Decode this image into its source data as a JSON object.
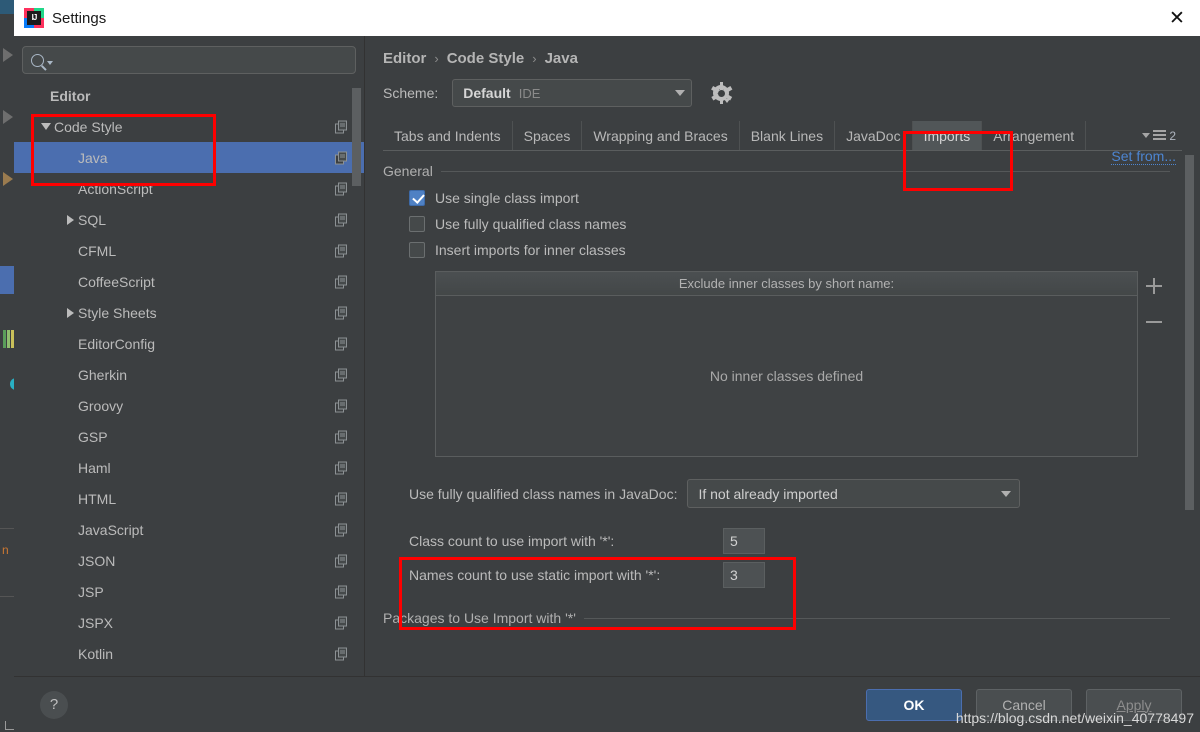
{
  "window": {
    "title": "Settings",
    "app_icon": "intellij-idea-icon",
    "close_label": "✕"
  },
  "sidebar": {
    "search": {
      "value": "",
      "placeholder": "",
      "icon": "search-icon"
    },
    "items": [
      {
        "label": "Editor",
        "type": "header",
        "indent": 0,
        "twisty": "none",
        "copy": false,
        "selected": false
      },
      {
        "label": "Code Style",
        "type": "group",
        "indent": 0,
        "twisty": "down",
        "copy": true,
        "selected": false
      },
      {
        "label": "Java",
        "type": "leaf",
        "indent": 1,
        "twisty": "none",
        "copy": true,
        "selected": true
      },
      {
        "label": "ActionScript",
        "type": "leaf",
        "indent": 1,
        "twisty": "none",
        "copy": true,
        "selected": false
      },
      {
        "label": "SQL",
        "type": "group",
        "indent": 1,
        "twisty": "right",
        "copy": true,
        "selected": false
      },
      {
        "label": "CFML",
        "type": "leaf",
        "indent": 1,
        "twisty": "none",
        "copy": true,
        "selected": false
      },
      {
        "label": "CoffeeScript",
        "type": "leaf",
        "indent": 1,
        "twisty": "none",
        "copy": true,
        "selected": false
      },
      {
        "label": "Style Sheets",
        "type": "group",
        "indent": 1,
        "twisty": "right",
        "copy": true,
        "selected": false
      },
      {
        "label": "EditorConfig",
        "type": "leaf",
        "indent": 1,
        "twisty": "none",
        "copy": true,
        "selected": false
      },
      {
        "label": "Gherkin",
        "type": "leaf",
        "indent": 1,
        "twisty": "none",
        "copy": true,
        "selected": false
      },
      {
        "label": "Groovy",
        "type": "leaf",
        "indent": 1,
        "twisty": "none",
        "copy": true,
        "selected": false
      },
      {
        "label": "GSP",
        "type": "leaf",
        "indent": 1,
        "twisty": "none",
        "copy": true,
        "selected": false
      },
      {
        "label": "Haml",
        "type": "leaf",
        "indent": 1,
        "twisty": "none",
        "copy": true,
        "selected": false
      },
      {
        "label": "HTML",
        "type": "leaf",
        "indent": 1,
        "twisty": "none",
        "copy": true,
        "selected": false
      },
      {
        "label": "JavaScript",
        "type": "leaf",
        "indent": 1,
        "twisty": "none",
        "copy": true,
        "selected": false
      },
      {
        "label": "JSON",
        "type": "leaf",
        "indent": 1,
        "twisty": "none",
        "copy": true,
        "selected": false
      },
      {
        "label": "JSP",
        "type": "leaf",
        "indent": 1,
        "twisty": "none",
        "copy": true,
        "selected": false
      },
      {
        "label": "JSPX",
        "type": "leaf",
        "indent": 1,
        "twisty": "none",
        "copy": true,
        "selected": false
      },
      {
        "label": "Kotlin",
        "type": "leaf",
        "indent": 1,
        "twisty": "none",
        "copy": true,
        "selected": false
      }
    ]
  },
  "content": {
    "breadcrumb": {
      "items": [
        "Editor",
        "Code Style",
        "Java"
      ],
      "separator": "›"
    },
    "scheme": {
      "label": "Scheme:",
      "name": "Default",
      "sub": "IDE",
      "gear_icon": "gear-icon"
    },
    "set_from_link": "Set from...",
    "tabs": [
      {
        "label": "Tabs and Indents",
        "active": false
      },
      {
        "label": "Spaces",
        "active": false
      },
      {
        "label": "Wrapping and Braces",
        "active": false
      },
      {
        "label": "Blank Lines",
        "active": false
      },
      {
        "label": "JavaDoc",
        "active": false
      },
      {
        "label": "Imports",
        "active": true
      },
      {
        "label": "Arrangement",
        "active": false
      }
    ],
    "tab_overflow_count": "2",
    "general": {
      "title": "General",
      "checkboxes": [
        {
          "label": "Use single class import",
          "checked": true
        },
        {
          "label": "Use fully qualified class names",
          "checked": false
        },
        {
          "label": "Insert imports for inner classes",
          "checked": false
        }
      ]
    },
    "exclude_table": {
      "header": "Exclude inner classes by short name:",
      "empty_text": "No inner classes defined",
      "add_button": "+",
      "remove_button": "−"
    },
    "javadoc": {
      "label": "Use fully qualified class names in JavaDoc:",
      "value": "If not already imported"
    },
    "counts": [
      {
        "label": "Class count to use import with '*':",
        "value": "5"
      },
      {
        "label": "Names count to use static import with '*':",
        "value": "3"
      }
    ],
    "packages_section_title": "Packages to Use Import with '*'"
  },
  "footer": {
    "help_label": "?",
    "ok_label": "OK",
    "cancel_label": "Cancel",
    "apply_label": "Apply"
  },
  "watermark": "https://blog.csdn.net/weixin_40778497",
  "colors": {
    "accent_selection": "#4b6eaf",
    "annotation": "#fe0000",
    "link": "#4d85d1",
    "panel_bg": "#3c3f41",
    "checkbox_checked": "#4f81c4"
  }
}
